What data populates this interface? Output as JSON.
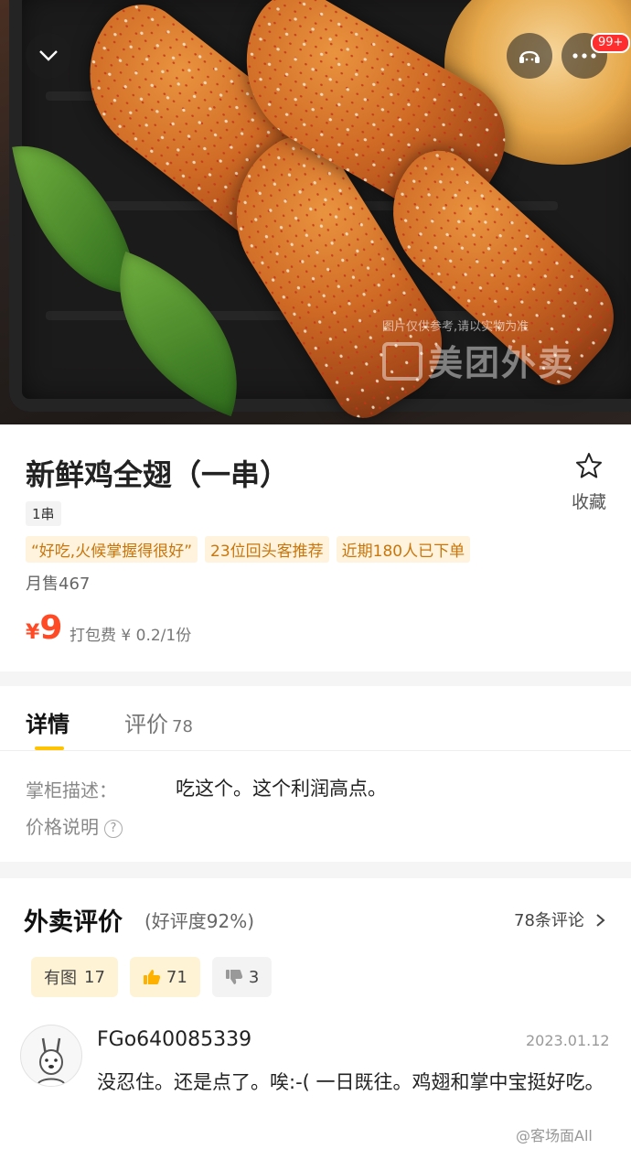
{
  "hero": {
    "watermark_note": "图片仅供参考,请以实物为准",
    "watermark_brand": "美团外卖",
    "badge": "99+",
    "icons": [
      "chevron-down-icon",
      "customer-service-icon",
      "more-icon"
    ]
  },
  "product": {
    "title": "新鲜鸡全翅（一串）",
    "spec": "1串",
    "favorite_label": "收藏",
    "tags": [
      "“好吃,火候掌握得很好”",
      "23位回头客推荐",
      "近期180人已下单"
    ],
    "monthly_sales": "月售467",
    "price_symbol": "¥",
    "price": "9",
    "packing_fee": "打包费 ¥ 0.2/1份"
  },
  "tabs": {
    "details": "详情",
    "reviews": "评价",
    "reviews_count": "78"
  },
  "details": {
    "description_label": "掌柜描述：",
    "description_value": "吃这个。这个利润高点。",
    "price_note_label": "价格说明",
    "price_note_icon": "?"
  },
  "reviews": {
    "title": "外卖评价",
    "rating": "(好评度92%)",
    "count_link": "78条评论",
    "filters": {
      "with_image_label": "有图",
      "with_image_count": "17",
      "thumbs_up_count": "71",
      "thumbs_down_count": "3"
    },
    "items": [
      {
        "user": "FGo640085339",
        "date": "2023.01.12",
        "text": "没忍住。还是点了。唉:-( 一日既往。鸡翅和掌中宝挺好吃。"
      }
    ]
  },
  "watermark": "@客场面All",
  "colors": {
    "accent_yellow": "#ffc300",
    "price_red": "#ff4a26",
    "tag_text": "#c8760b",
    "tag_bg": "#fff3de"
  }
}
